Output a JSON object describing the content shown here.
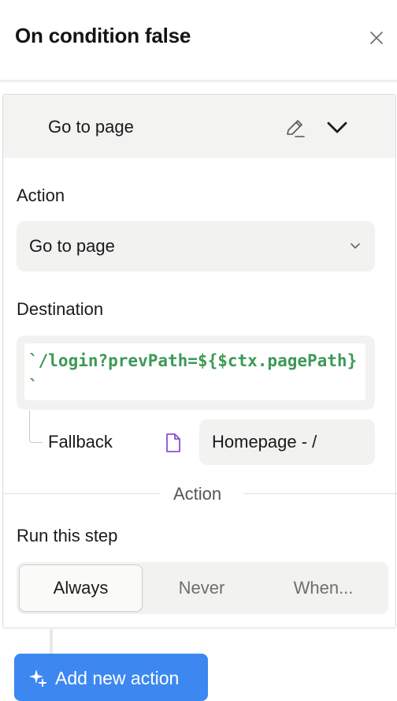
{
  "header": {
    "title": "On condition false",
    "close_icon": "close-icon"
  },
  "step": {
    "title": "Go to page",
    "edit_icon": "pencil-icon",
    "collapse_icon": "chevron-down-icon"
  },
  "action": {
    "label": "Action",
    "value": "Go to page"
  },
  "destination": {
    "label": "Destination",
    "value": "`/login?prevPath=${$ctx.pagePath}`"
  },
  "fallback": {
    "label": "Fallback",
    "icon": "page-icon",
    "value": "Homepage - /"
  },
  "section": {
    "label": "Action"
  },
  "run_step": {
    "label": "Run this step",
    "options": [
      "Always",
      "Never",
      "When..."
    ],
    "selected": "Always"
  },
  "footer": {
    "add_label": "Add new action",
    "add_icon": "sparkle-plus-icon"
  },
  "colors": {
    "accent": "#3d88f0",
    "code": "#3c9a57",
    "file_icon": "#8b4fd6"
  }
}
